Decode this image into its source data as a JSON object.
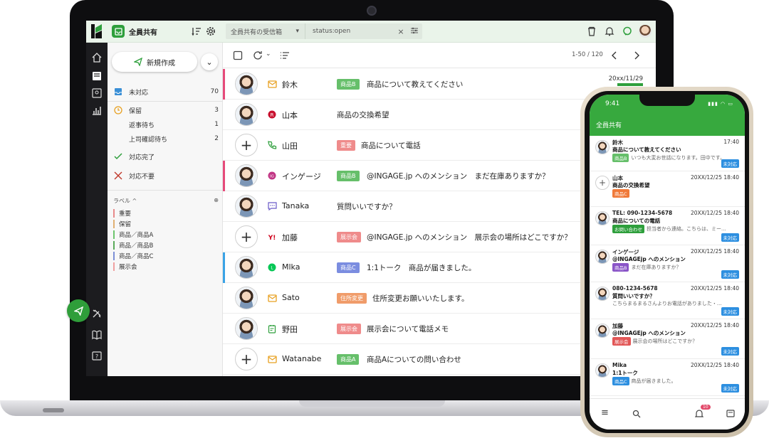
{
  "topbar": {
    "inbox_name": "全員共有",
    "search_scope": "全員共有の受信箱",
    "search_query": "status:open"
  },
  "sidebar": {
    "compose_label": "新規作成",
    "items": [
      {
        "label": "未対応",
        "count": "70"
      },
      {
        "label": "保留",
        "count": "3"
      },
      {
        "label": "返事待ち",
        "count": "1"
      },
      {
        "label": "上司確認待ち",
        "count": "2"
      },
      {
        "label": "対応完了",
        "count": ""
      },
      {
        "label": "対応不要",
        "count": ""
      }
    ],
    "labels_header": "ラベル ^",
    "labels": [
      {
        "name": "重要",
        "color": "#e88a8a"
      },
      {
        "name": "保留",
        "color": "#e0b072"
      },
      {
        "name": "商品／商品A",
        "color": "#6dc56d"
      },
      {
        "name": "商品／商品B",
        "color": "#5aaa5a"
      },
      {
        "name": "商品／商品C",
        "color": "#7c8fd6"
      },
      {
        "name": "展示会",
        "color": "#f0a0a0"
      }
    ]
  },
  "main": {
    "pager": "1-50 / 120",
    "rows": [
      {
        "name": "鈴木",
        "tag": "商品B",
        "tag_color": "#66bf6a",
        "subject": "商品について教えてください",
        "date": "20xx/11/29",
        "accent": "#e64a7a",
        "avatar": "face",
        "channel": "mail-icon"
      },
      {
        "name": "山本",
        "tag": "",
        "tag_color": "",
        "subject": "商品の交換希望",
        "date": "",
        "accent": "",
        "avatar": "face",
        "channel": "rakuten-icon"
      },
      {
        "name": "山田",
        "tag": "重要",
        "tag_color": "#ef8b8b",
        "subject": "商品について電話",
        "date": "",
        "accent": "",
        "avatar": "plus",
        "channel": "phone-icon"
      },
      {
        "name": "インゲージ",
        "tag": "商品B",
        "tag_color": "#66bf6a",
        "subject": "@INGAGE.jp へのメンション　まだ在庫ありますか？",
        "date": "",
        "accent": "#e64a7a",
        "avatar": "face",
        "channel": "instagram-icon"
      },
      {
        "name": "Tanaka",
        "tag": "",
        "tag_color": "",
        "subject": "質問いいですか？",
        "date": "",
        "accent": "",
        "avatar": "face",
        "channel": "chat-icon"
      },
      {
        "name": "加藤",
        "tag": "展示会",
        "tag_color": "#ef8b8b",
        "subject": "@INGAGE.jp へのメンション　展示会の場所はどこですか？",
        "date": "",
        "accent": "",
        "avatar": "plus",
        "channel": "yahoo-icon"
      },
      {
        "name": "Mlka",
        "tag": "商品C",
        "tag_color": "#7b8de0",
        "subject": "1:1トーク　商品が届きました。",
        "date": "",
        "accent": "#3aa3e6",
        "avatar": "face",
        "channel": "line-icon"
      },
      {
        "name": "Sato",
        "tag": "住所変更",
        "tag_color": "#f09c6a",
        "subject": "住所変更お願いいたします。",
        "date": "",
        "accent": "",
        "avatar": "face",
        "channel": "mail-icon"
      },
      {
        "name": "野田",
        "tag": "展示会",
        "tag_color": "#ef8b8b",
        "subject": "展示会について電話メモ",
        "date": "",
        "accent": "",
        "avatar": "face",
        "channel": "memo-icon"
      },
      {
        "name": "Watanabe",
        "tag": "商品A",
        "tag_color": "#66bf6a",
        "subject": "商品Aについての問い合わせ",
        "date": "",
        "accent": "",
        "avatar": "plus",
        "channel": "mail-icon"
      }
    ]
  },
  "phone": {
    "time": "9:41",
    "title": "全員共有",
    "items": [
      {
        "line1": "鈴木",
        "date": "17:40",
        "line2": "商品について教えてください",
        "tag": "商品B",
        "tag_color": "#66bf6a",
        "preview": "いつも大変お世話になります。田中です。",
        "badge": "未対応"
      },
      {
        "line1": "山本",
        "date": "20XX/12/25 18:40",
        "line2": "商品の交換希望",
        "tag": "商品C",
        "tag_color": "#f07a3a",
        "preview": "",
        "badge": ""
      },
      {
        "line1": "TEL: 090-1234-5678",
        "date": "20XX/12/25 18:40",
        "line2": "商品についての電話",
        "tag": "お問い合わせ",
        "tag_color": "#2e9f3c",
        "preview": "担当者から連絡。こちらは、ミー...",
        "badge": "未対応"
      },
      {
        "line1": "インゲージ",
        "date": "20XX/12/25 18:40",
        "line2": "@INGAGEjp へのメンション",
        "tag": "商品B",
        "tag_color": "#8a55c8",
        "preview": "まだ在庫ありますか？",
        "badge": "未対応"
      },
      {
        "line1": "080-1234-5678",
        "date": "20XX/12/25 18:40",
        "line2": "質問いいですか？",
        "tag": "",
        "tag_color": "",
        "preview": "こちらまるまるさんよりお電話がありました・...",
        "badge": "未対応"
      },
      {
        "line1": "加藤",
        "date": "20XX/12/25 18:40",
        "line2": "@INGAGEjp へのメンション",
        "tag": "展示会",
        "tag_color": "#e25656",
        "preview": "展示会の場所はどこですか？",
        "badge": "未対応"
      },
      {
        "line1": "Mika",
        "date": "20XX/12/25 18:40",
        "line2": "1:1トーク",
        "tag": "商品C",
        "tag_color": "#2d8fe0",
        "preview": "商品が届きました。",
        "badge": "未対応"
      }
    ],
    "notif_count": "10"
  }
}
